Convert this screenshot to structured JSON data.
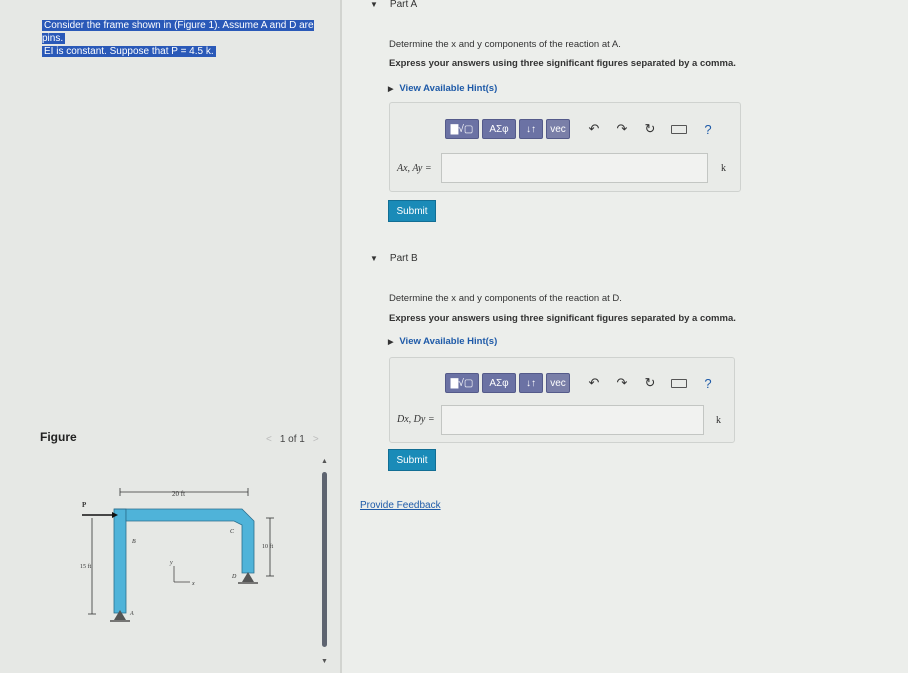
{
  "problem": {
    "line1": "Consider the frame shown in (Figure 1). Assume A and D are pins.",
    "line2": "EI is constant. Suppose that P = 4.5 k."
  },
  "figure": {
    "label": "Figure",
    "pager_text": "1 of 1",
    "prev_arrow": "<",
    "next_arrow": ">",
    "scroll_up": "▲",
    "scroll_down": "▼",
    "dims": {
      "top_width": "20 ft",
      "right_height": "10 ft",
      "left_height": "15 ft"
    },
    "points": {
      "load": "P",
      "A": "A",
      "B": "B",
      "C": "C",
      "D": "D",
      "axis_y": "y",
      "axis_x": "x"
    }
  },
  "partA": {
    "toggle": "▼",
    "title": "Part A",
    "question": "Determine the x and y components of the reaction at A.",
    "instruction": "Express your answers using three significant figures separated by a comma.",
    "hint_arrow": "▶",
    "hint": "View Available Hint(s)",
    "answer_label": "Ax, Ay =",
    "answer_value": "",
    "unit": "k",
    "submit": "Submit"
  },
  "partB": {
    "toggle": "▼",
    "title": "Part B",
    "question": "Determine the x and y components of the reaction at D.",
    "instruction": "Express your answers using three significant figures separated by a comma.",
    "hint_arrow": "▶",
    "hint": "View Available Hint(s)",
    "answer_label": "Dx, Dy =",
    "answer_value": "",
    "unit": "k",
    "submit": "Submit"
  },
  "toolbar": {
    "templates": "▇√▢",
    "greek": "ΑΣφ",
    "arrows": "↓↑",
    "vec": "vec",
    "undo": "↶",
    "redo": "↷",
    "reset": "↻",
    "help": "?"
  },
  "feedback": "Provide Feedback",
  "colors": {
    "toolbar_button": "#6b72a4",
    "submit_button": "#1a8bb8",
    "link": "#1e5aa8",
    "highlight": "#2a59b8",
    "frame_member": "#4fb3d9"
  }
}
